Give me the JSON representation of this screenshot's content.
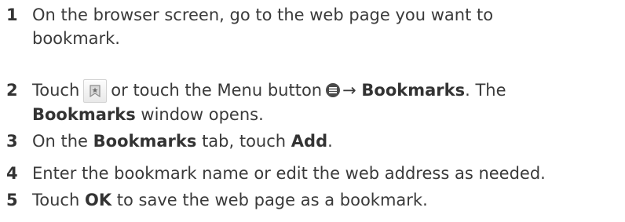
{
  "steps": [
    {
      "number": "1",
      "line1": "On the browser screen, go to the web page you want to",
      "line2": "bookmark."
    },
    {
      "number": "2",
      "touch": "Touch",
      "or_touch_menu": "or touch the Menu button",
      "arrow": "→",
      "bookmarks_bold": "Bookmarks",
      "the": ". The",
      "bookmarks_window_bold": "Bookmarks",
      "window_opens": "window opens."
    },
    {
      "number": "3",
      "on_the": "On the",
      "bookmarks_bold": "Bookmarks",
      "tab_touch": "tab, touch",
      "add_bold": "Add",
      "period": "."
    },
    {
      "number": "4",
      "text": "Enter the bookmark name or edit the web address as needed."
    },
    {
      "number": "5",
      "touch": "Touch",
      "ok_bold": "OK",
      "rest": "to save the web page as a bookmark."
    }
  ],
  "icons": {
    "bookmark": "bookmark-icon",
    "menu": "menu-icon"
  }
}
